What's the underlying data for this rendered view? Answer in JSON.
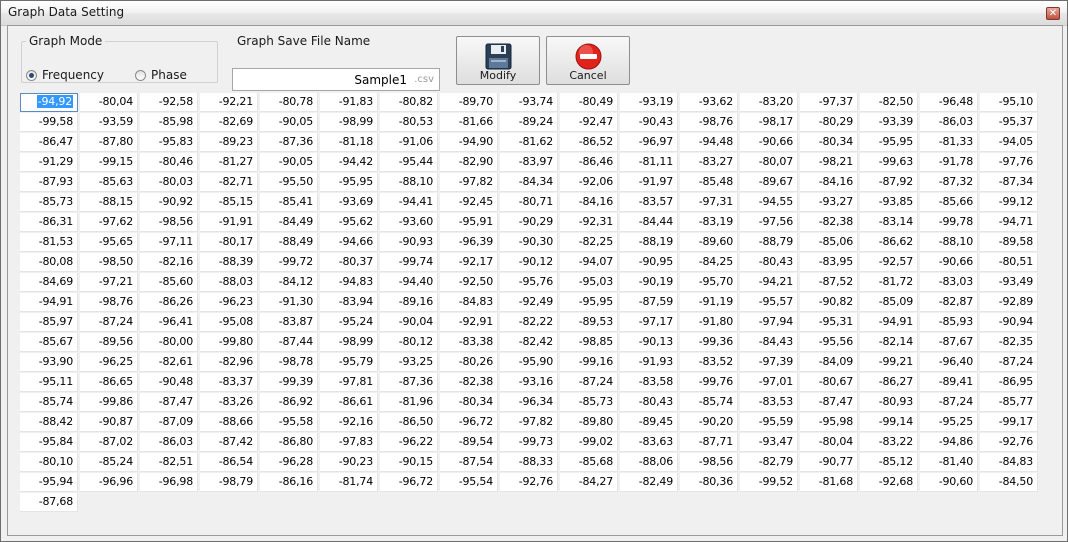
{
  "window": {
    "title": "Graph Data Setting",
    "close_glyph": "✕"
  },
  "graph_mode": {
    "legend": "Graph Mode",
    "options": [
      {
        "label": "Frequency",
        "selected": true
      },
      {
        "label": "Phase",
        "selected": false
      }
    ]
  },
  "save_file": {
    "legend": "Graph Save File Name",
    "value": "Sample1",
    "extension": ".csv"
  },
  "buttons": {
    "modify": {
      "label": "Modify",
      "icon": "floppy-disk-icon"
    },
    "cancel": {
      "label": "Cancel",
      "icon": "cancel-icon"
    }
  },
  "grid": {
    "columns": 17,
    "selected_index": 0,
    "values": [
      "-94,92",
      "-80,04",
      "-92,58",
      "-92,21",
      "-80,78",
      "-91,83",
      "-80,82",
      "-89,70",
      "-93,74",
      "-80,49",
      "-93,19",
      "-93,62",
      "-83,20",
      "-97,37",
      "-82,50",
      "-96,48",
      "-95,10",
      "-99,58",
      "-93,59",
      "-85,98",
      "-82,69",
      "-90,05",
      "-98,99",
      "-80,53",
      "-81,66",
      "-89,24",
      "-92,47",
      "-90,43",
      "-98,76",
      "-98,17",
      "-80,29",
      "-93,39",
      "-86,03",
      "-95,37",
      "-86,47",
      "-87,80",
      "-95,83",
      "-89,23",
      "-87,36",
      "-81,18",
      "-91,06",
      "-94,90",
      "-81,62",
      "-86,52",
      "-96,97",
      "-94,48",
      "-90,66",
      "-80,34",
      "-95,95",
      "-81,33",
      "-94,05",
      "-91,29",
      "-99,15",
      "-80,46",
      "-81,27",
      "-90,05",
      "-94,42",
      "-95,44",
      "-82,90",
      "-83,97",
      "-86,46",
      "-81,11",
      "-83,27",
      "-80,07",
      "-98,21",
      "-99,63",
      "-91,78",
      "-97,76",
      "-87,93",
      "-85,63",
      "-80,03",
      "-82,71",
      "-95,50",
      "-95,95",
      "-88,10",
      "-97,82",
      "-84,34",
      "-92,06",
      "-91,97",
      "-85,48",
      "-89,67",
      "-84,16",
      "-87,92",
      "-87,32",
      "-87,34",
      "-85,73",
      "-88,15",
      "-90,92",
      "-85,15",
      "-85,41",
      "-93,69",
      "-94,41",
      "-92,45",
      "-80,71",
      "-84,16",
      "-83,57",
      "-97,31",
      "-94,55",
      "-93,27",
      "-93,85",
      "-85,66",
      "-99,12",
      "-86,31",
      "-97,62",
      "-98,56",
      "-91,91",
      "-84,49",
      "-95,62",
      "-93,60",
      "-95,91",
      "-90,29",
      "-92,31",
      "-84,44",
      "-83,19",
      "-97,56",
      "-82,38",
      "-83,14",
      "-99,78",
      "-94,71",
      "-81,53",
      "-95,65",
      "-97,11",
      "-80,17",
      "-88,49",
      "-94,66",
      "-90,93",
      "-96,39",
      "-90,30",
      "-82,25",
      "-88,19",
      "-89,60",
      "-88,79",
      "-85,06",
      "-86,62",
      "-88,10",
      "-89,58",
      "-80,08",
      "-98,50",
      "-82,16",
      "-88,39",
      "-99,72",
      "-80,37",
      "-99,74",
      "-92,17",
      "-90,12",
      "-94,07",
      "-90,95",
      "-84,25",
      "-80,43",
      "-83,95",
      "-92,57",
      "-90,66",
      "-80,51",
      "-84,69",
      "-97,21",
      "-85,60",
      "-88,03",
      "-84,12",
      "-94,83",
      "-94,40",
      "-92,50",
      "-95,76",
      "-95,03",
      "-90,19",
      "-95,70",
      "-94,21",
      "-87,52",
      "-81,72",
      "-83,03",
      "-93,49",
      "-94,91",
      "-98,76",
      "-86,26",
      "-96,23",
      "-91,30",
      "-83,94",
      "-89,16",
      "-84,83",
      "-92,49",
      "-95,95",
      "-87,59",
      "-91,19",
      "-95,57",
      "-90,82",
      "-85,09",
      "-82,87",
      "-92,89",
      "-85,97",
      "-87,24",
      "-96,41",
      "-95,08",
      "-83,87",
      "-95,24",
      "-90,04",
      "-92,91",
      "-82,22",
      "-89,53",
      "-97,17",
      "-91,80",
      "-97,94",
      "-95,31",
      "-94,91",
      "-85,93",
      "-90,94",
      "-85,67",
      "-89,56",
      "-80,00",
      "-99,80",
      "-87,44",
      "-98,99",
      "-80,12",
      "-83,38",
      "-82,42",
      "-98,85",
      "-90,13",
      "-99,36",
      "-84,43",
      "-95,56",
      "-82,14",
      "-87,67",
      "-82,35",
      "-93,90",
      "-96,25",
      "-82,61",
      "-82,96",
      "-98,78",
      "-95,79",
      "-93,25",
      "-80,26",
      "-95,90",
      "-99,16",
      "-91,93",
      "-83,52",
      "-97,39",
      "-84,09",
      "-99,21",
      "-96,40",
      "-87,24",
      "-95,11",
      "-86,65",
      "-90,48",
      "-83,37",
      "-99,39",
      "-97,81",
      "-87,36",
      "-82,38",
      "-93,16",
      "-87,24",
      "-83,58",
      "-99,76",
      "-97,01",
      "-80,67",
      "-86,27",
      "-89,41",
      "-86,95",
      "-85,74",
      "-99,86",
      "-87,47",
      "-83,26",
      "-86,92",
      "-86,61",
      "-81,96",
      "-80,34",
      "-96,34",
      "-85,73",
      "-80,43",
      "-85,74",
      "-83,53",
      "-87,47",
      "-80,93",
      "-87,24",
      "-85,77",
      "-88,42",
      "-90,87",
      "-87,09",
      "-88,66",
      "-95,58",
      "-92,16",
      "-86,50",
      "-96,72",
      "-97,82",
      "-89,80",
      "-89,45",
      "-90,20",
      "-95,59",
      "-95,98",
      "-99,14",
      "-95,25",
      "-99,17",
      "-95,84",
      "-87,02",
      "-86,03",
      "-87,42",
      "-86,80",
      "-97,83",
      "-96,22",
      "-89,54",
      "-99,73",
      "-99,02",
      "-83,63",
      "-87,71",
      "-93,47",
      "-80,04",
      "-83,22",
      "-94,86",
      "-92,76",
      "-80,10",
      "-85,24",
      "-82,51",
      "-86,54",
      "-96,28",
      "-90,23",
      "-90,15",
      "-87,54",
      "-88,33",
      "-85,68",
      "-88,06",
      "-98,56",
      "-82,79",
      "-90,77",
      "-85,12",
      "-81,40",
      "-84,83",
      "-95,94",
      "-96,96",
      "-96,98",
      "-98,79",
      "-86,16",
      "-81,74",
      "-96,72",
      "-95,54",
      "-92,76",
      "-84,27",
      "-82,49",
      "-80,36",
      "-99,52",
      "-81,68",
      "-92,68",
      "-90,60",
      "-84,50",
      "-87,68"
    ]
  }
}
